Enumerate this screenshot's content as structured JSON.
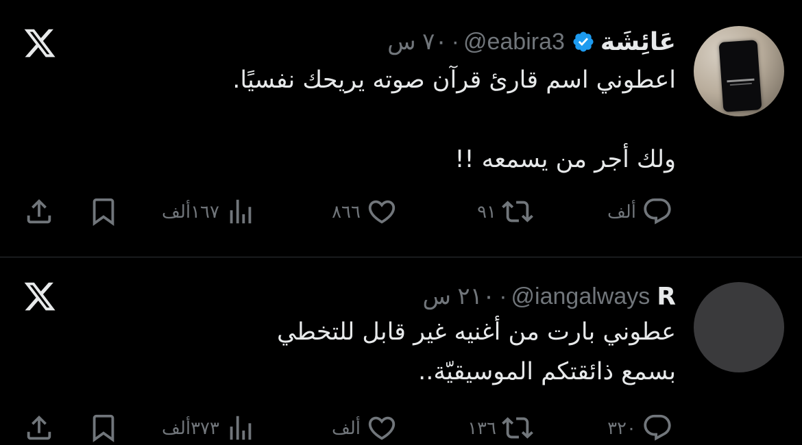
{
  "tweets": [
    {
      "display_name": "عَائِشَة",
      "verified": true,
      "handle": "@eabira3",
      "separator": "·",
      "time": "٧٠ س",
      "text": "اعطوني اسم قارئ قرآن صوته يريحك نفسيًا.\n\nولك أجر من يسمعه !!",
      "replies": "ألف",
      "retweets": "٩١",
      "likes": "٨٦٦",
      "views": "١٦٧ألف",
      "avatar": "phone-photo"
    },
    {
      "display_name": "R",
      "verified": false,
      "handle": "@iangalways",
      "separator": "·",
      "time": "٢١٠ س",
      "text": "عطوني بارت من أغنيه غير قابل للتخطي\nبسمع ذائقتكم الموسيقيّة..",
      "replies": "٣٢٠",
      "retweets": "١٣٦",
      "likes": "ألف",
      "views": "٣٧٣ألف",
      "avatar": "gray-circle"
    }
  ],
  "icons": {
    "logo": "x-logo-icon",
    "reply": "reply-icon",
    "retweet": "retweet-icon",
    "like": "heart-icon",
    "views": "views-icon",
    "bookmark": "bookmark-icon",
    "share": "share-icon",
    "verified": "verified-badge-icon"
  },
  "colors": {
    "background": "#000000",
    "text": "#e7e9ea",
    "muted": "#71767b",
    "verified": "#1d9bf0",
    "divider": "#2f3336"
  }
}
